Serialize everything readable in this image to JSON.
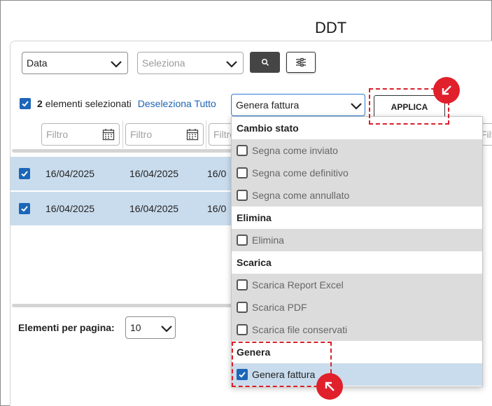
{
  "title": "DDT",
  "toolbar": {
    "date_select_value": "Data",
    "seleziona_placeholder": "Seleziona",
    "search_icon": "search-icon",
    "settings_icon": "sliders-icon"
  },
  "selection": {
    "count": "2",
    "label": "elementi selezionati",
    "deselect_all": "Deseleziona Tutto"
  },
  "action": {
    "selected": "Genera fattura",
    "apply_label": "APPLICA"
  },
  "filters": {
    "placeholder": "Filtro",
    "col3_placeholder": "Filtro",
    "col_right_placeholder": "Filt"
  },
  "table": {
    "rows": [
      {
        "col1": "16/04/2025",
        "col2": "16/04/2025",
        "col3": "16/0"
      },
      {
        "col1": "16/04/2025",
        "col2": "16/04/2025",
        "col3": "16/0"
      }
    ]
  },
  "pagination": {
    "label": "Elementi per pagina:",
    "value": "10"
  },
  "dropdown": {
    "group_cambio_stato": "Cambio stato",
    "segna_inviato": "Segna come inviato",
    "segna_definitivo": "Segna come definitivo",
    "segna_annullato": "Segna come annullato",
    "group_elimina": "Elimina",
    "elimina": "Elimina",
    "group_scarica": "Scarica",
    "scarica_excel": "Scarica Report Excel",
    "scarica_pdf": "Scarica PDF",
    "scarica_conservati": "Scarica file conservati",
    "group_genera": "Genera",
    "genera_fattura": "Genera fattura"
  },
  "annotations": {
    "highlight_color": "#d9202a",
    "badge_apply_icon": "arrow-down-left-icon",
    "badge_genera_icon": "arrow-up-left-icon"
  }
}
